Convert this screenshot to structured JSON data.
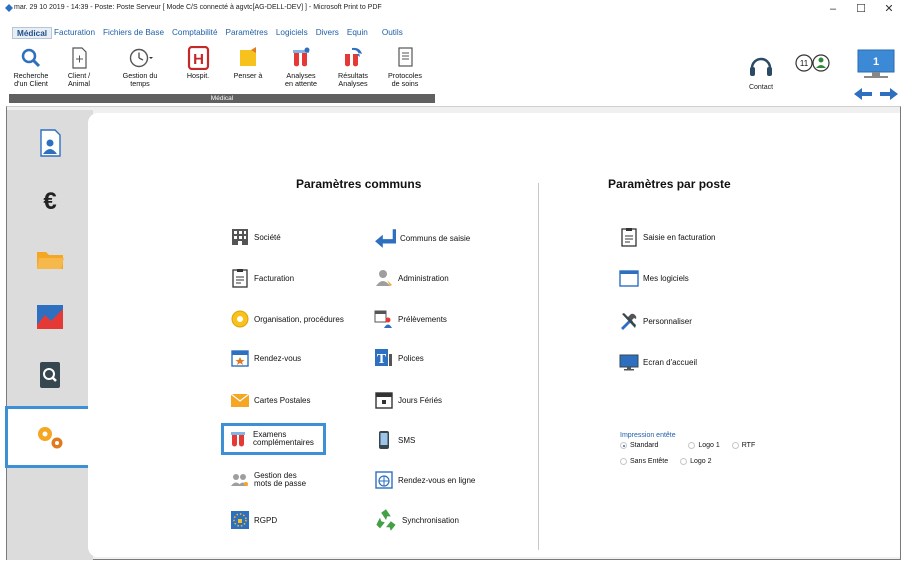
{
  "window": {
    "title": "mar. 29 10 2019 - 14:39 - Poste: Poste Serveur  [ Mode C/S connecté à agvtc[AG-DELL-DEV] ] - Microsoft Print to PDF",
    "minimize": "–",
    "maximize": "☐",
    "close": "✕"
  },
  "menu": [
    "Médical",
    "Facturation",
    "Fichiers de Base",
    "Comptabilité",
    "Paramètres",
    "Logiciels",
    "Divers",
    "Equin",
    "Outils"
  ],
  "ribbon": {
    "buttons": [
      {
        "label": "Recherche\nd'un Client",
        "icon": "search-icon"
      },
      {
        "label": "Client /\nAnimal",
        "icon": "document-icon"
      },
      {
        "label": "Gestion du\ntemps",
        "icon": "clock-icon"
      },
      {
        "label": "Hospit.",
        "icon": "hospital-icon"
      },
      {
        "label": "Penser à",
        "icon": "sticky-note-icon"
      },
      {
        "label": "Analyses\nen attente",
        "icon": "lab-flasks-icon"
      },
      {
        "label": "Résultats\nAnalyses",
        "icon": "lab-results-icon"
      },
      {
        "label": "Protocoles\nde soins",
        "icon": "protocol-icon"
      }
    ],
    "group_label": "Médical"
  },
  "right_tools": {
    "contact_label": "Contact",
    "badge_count": "11",
    "screen_number": "1"
  },
  "sidebar": [
    {
      "icon": "person-card-icon"
    },
    {
      "icon": "euro-icon"
    },
    {
      "icon": "folder-icon"
    },
    {
      "icon": "chart-icon"
    },
    {
      "icon": "search-document-icon"
    },
    {
      "icon": "gears-icon",
      "selected": true
    }
  ],
  "params_communs": {
    "title": "Paramètres communs",
    "items": [
      {
        "label": "Société",
        "icon": "building-icon"
      },
      {
        "label": "Communs de saisie",
        "icon": "return-arrow-icon"
      },
      {
        "label": "Facturation",
        "icon": "clipboard-icon"
      },
      {
        "label": "Administration",
        "icon": "admin-user-icon"
      },
      {
        "label": "Organisation, procédures",
        "icon": "gear-flower-icon"
      },
      {
        "label": "Prélèvements",
        "icon": "calendar-people-icon"
      },
      {
        "label": "Rendez-vous",
        "icon": "calendar-star-icon"
      },
      {
        "label": "Polices",
        "icon": "font-icon"
      },
      {
        "label": "Cartes Postales",
        "icon": "envelope-icon"
      },
      {
        "label": "Jours Fériés",
        "icon": "calendar-day-icon"
      },
      {
        "label": "Examens\ncomplémentaires",
        "icon": "test-tubes-icon",
        "highlighted": true
      },
      {
        "label": "SMS",
        "icon": "phone-icon"
      },
      {
        "label": "Gestion des\nmots de passe",
        "icon": "users-key-icon"
      },
      {
        "label": "Rendez-vous en ligne",
        "icon": "online-calendar-icon"
      },
      {
        "label": "RGPD",
        "icon": "gdpr-icon"
      },
      {
        "label": "Synchronisation",
        "icon": "recycle-icon"
      }
    ]
  },
  "params_poste": {
    "title": "Paramètres par poste",
    "items": [
      {
        "label": "Saisie en facturation",
        "icon": "clipboard-icon"
      },
      {
        "label": "Mes logiciels",
        "icon": "window-icon"
      },
      {
        "label": "Personnaliser",
        "icon": "tools-icon"
      },
      {
        "label": "Ecran d'accueil",
        "icon": "monitor-icon"
      }
    ],
    "impression": {
      "label": "Impression entête",
      "options": [
        {
          "label": "Standard",
          "selected": true
        },
        {
          "label": "Logo 1",
          "selected": false
        },
        {
          "label": "RTF",
          "selected": false
        },
        {
          "label": "Sans Entête",
          "selected": false
        },
        {
          "label": "Logo 2",
          "selected": false
        }
      ]
    }
  }
}
